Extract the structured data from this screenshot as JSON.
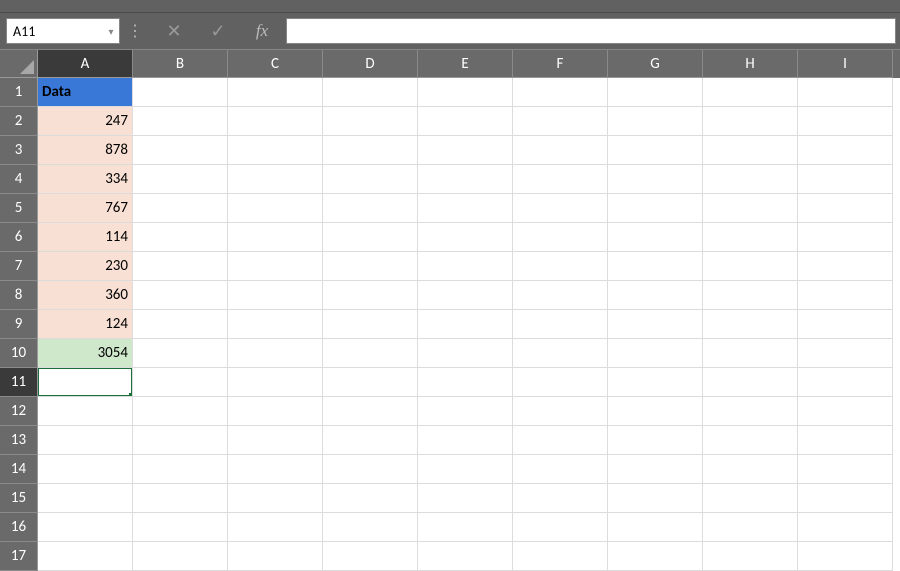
{
  "name_box": "A11",
  "formula_value": "",
  "columns": [
    "A",
    "B",
    "C",
    "D",
    "E",
    "F",
    "G",
    "H",
    "I"
  ],
  "rows": [
    "1",
    "2",
    "3",
    "4",
    "5",
    "6",
    "7",
    "8",
    "9",
    "10",
    "11",
    "12",
    "13",
    "14",
    "15",
    "16",
    "17"
  ],
  "selected_col": "A",
  "selected_row": "11",
  "header_label": "Data",
  "data_values": [
    "247",
    "878",
    "334",
    "767",
    "114",
    "230",
    "360",
    "124"
  ],
  "sum_value": "3054",
  "icons": {
    "sep": "⋮",
    "cancel": "✕",
    "confirm": "✓",
    "fx": "fx",
    "dropdown": "▾"
  }
}
